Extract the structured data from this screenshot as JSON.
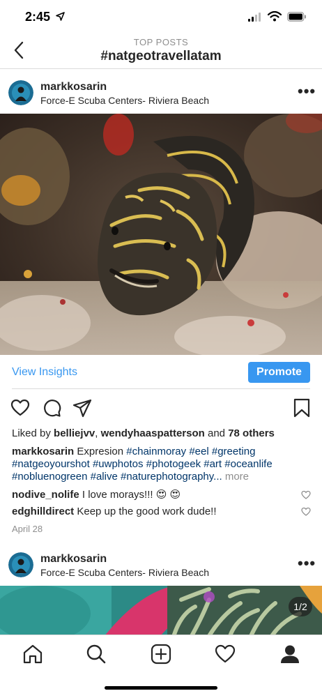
{
  "status": {
    "time": "2:45"
  },
  "header": {
    "subtitle": "TOP POSTS",
    "title": "#natgeotravellatam"
  },
  "post1": {
    "username": "markkosarin",
    "location": "Force-E Scuba Centers- Riviera Beach",
    "view_insights": "View Insights",
    "promote": "Promote",
    "likes": {
      "prefix": "Liked by ",
      "user1": "belliejvv",
      "sep": ", ",
      "user2": "wendyhaaspatterson",
      "and": " and ",
      "others": "78 others"
    },
    "caption": {
      "username": "markkosarin",
      "text": "Expresion",
      "tags_line1": [
        "#chainmoray",
        "#eel",
        "#greeting"
      ],
      "tags_line2": [
        "#natgeoyourshot",
        "#uwphotos",
        "#photogeek",
        "#art",
        "#oceanlife"
      ],
      "tags_line3": [
        "#nobluenogreen",
        "#alive",
        "#naturephotography..."
      ],
      "more": "more"
    },
    "comments": [
      {
        "username": "nodive_nolife",
        "text": "I love morays!!!",
        "emoji": "😍 😍"
      },
      {
        "username": "edghilldirect",
        "text": "Keep up the good work dude!!"
      }
    ],
    "date": "April 28"
  },
  "post2": {
    "username": "markkosarin",
    "location": "Force-E Scuba Centers- Riviera Beach",
    "counter": "1/2"
  },
  "icons": {
    "status": [
      "location-arrow-icon",
      "signal-icon",
      "wifi-icon",
      "battery-icon"
    ],
    "actions": [
      "heart-icon",
      "comment-icon",
      "share-icon",
      "bookmark-icon"
    ],
    "tabs": [
      "home-icon",
      "search-icon",
      "add-post-icon",
      "activity-heart-icon",
      "profile-icon"
    ]
  }
}
